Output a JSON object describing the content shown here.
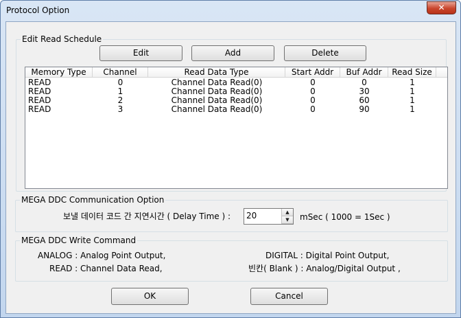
{
  "window": {
    "title": "Protocol Option",
    "close_glyph": "✕"
  },
  "schedule": {
    "legend": "Edit Read Schedule",
    "edit_label": "Edit",
    "add_label": "Add",
    "delete_label": "Delete",
    "columns": [
      "Memory Type",
      "Channel",
      "Read Data Type",
      "Start Addr",
      "Buf Addr",
      "Read Size"
    ],
    "rows": [
      [
        "READ",
        "0",
        "Channel Data Read(0)",
        "0",
        "0",
        "1"
      ],
      [
        "READ",
        "1",
        "Channel Data Read(0)",
        "0",
        "30",
        "1"
      ],
      [
        "READ",
        "2",
        "Channel Data Read(0)",
        "0",
        "60",
        "1"
      ],
      [
        "READ",
        "3",
        "Channel Data Read(0)",
        "0",
        "90",
        "1"
      ]
    ]
  },
  "comm": {
    "legend": "MEGA DDC Communication Option",
    "delay_label": "보낼 데이터 코드 간 지연시간 ( Delay Time ) :",
    "delay_value": "20",
    "unit_label": "mSec ( 1000 = 1Sec )"
  },
  "write": {
    "legend": "MEGA DDC Write Command",
    "analog": "ANALOG : Analog Point Output,",
    "read": "READ : Channel Data Read,",
    "digital": "DIGITAL : Digital Point Output,",
    "blank": "빈칸( Blank ) : Analog/Digital Output ,"
  },
  "footer": {
    "ok_label": "OK",
    "cancel_label": "Cancel"
  }
}
